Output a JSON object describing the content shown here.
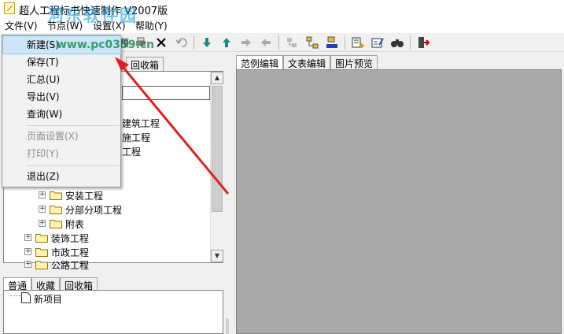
{
  "window": {
    "title": "超人工程标书快速制作 V2007版"
  },
  "menubar": [
    {
      "label": "文件(V)"
    },
    {
      "label": "节点(W)"
    },
    {
      "label": "设置(X)"
    },
    {
      "label": "帮助(Y)"
    }
  ],
  "file_menu": {
    "items": [
      {
        "label": "新建(S)",
        "state": "highlighted"
      },
      {
        "label": "保存(T)"
      },
      {
        "label": "汇总(U)"
      },
      {
        "label": "导出(V)"
      },
      {
        "label": "查询(W)"
      },
      {
        "label": "页面设置(X)",
        "state": "disabled"
      },
      {
        "label": "打印(Y)",
        "state": "disabled"
      },
      {
        "label": "退出(Z)"
      }
    ]
  },
  "left_pane": {
    "top_tabs": [
      {
        "label": "回收箱"
      }
    ],
    "tree_items": [
      {
        "label": "建筑工程"
      },
      {
        "label": "施工程"
      },
      {
        "label": "工程"
      },
      {
        "label": "安装工程"
      },
      {
        "label": "分部分项工程"
      },
      {
        "label": "附表"
      },
      {
        "label": "装饰工程"
      },
      {
        "label": "市政工程"
      },
      {
        "label": "公路工程"
      }
    ],
    "bottom_tabs": [
      {
        "label": "普通"
      },
      {
        "label": "收藏"
      },
      {
        "label": "回收箱"
      }
    ],
    "bottom_tree": [
      {
        "label": "新项目"
      }
    ]
  },
  "right_pane": {
    "tabs": [
      {
        "label": "范例编辑"
      },
      {
        "label": "文表编辑"
      },
      {
        "label": "图片预览"
      }
    ]
  },
  "toolbar": {
    "visible_text": "预",
    "icons": [
      "delete-icon",
      "undo-icon",
      "move-down-icon",
      "move-up-icon",
      "move-right-icon",
      "move-left-icon",
      "tree-node-icon",
      "tree-structure-icon",
      "tree-expand-icon",
      "add-item-icon",
      "edit-item-icon",
      "find-icon",
      "exit-icon"
    ]
  },
  "watermark": {
    "text": "河东软件园",
    "url": "www.pc0359.cn"
  },
  "colors": {
    "canvas": "#a9a9a9",
    "menu_highlight": "#cde6f7",
    "arrow": "#e02020"
  }
}
